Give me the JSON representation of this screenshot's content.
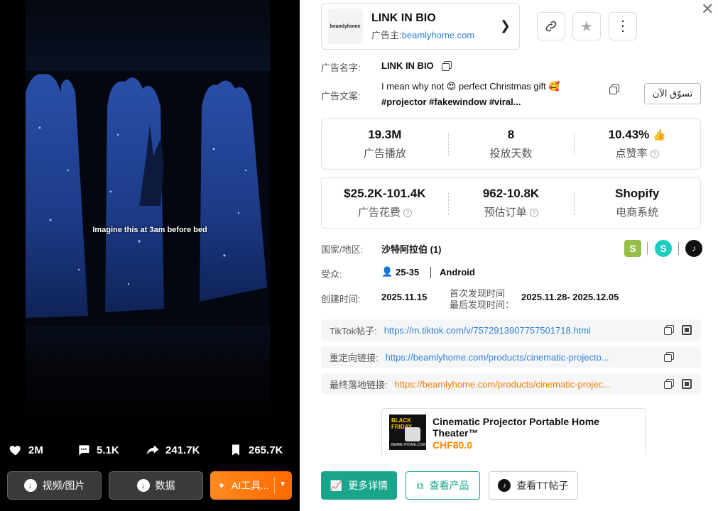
{
  "video": {
    "subtitle": "Imagine this at 3am before bed",
    "stats": {
      "likes": "2M",
      "comments": "5.1K",
      "shares": "241.7K",
      "saves": "265.7K"
    },
    "buttons": {
      "download_media": "视频/图片",
      "download_data": "数据",
      "ai_tools": "AI工具..."
    }
  },
  "advertiser": {
    "logo_text": "beamlyhome",
    "title": "LINK IN BIO",
    "advertiser_label": "广告主:",
    "advertiser_domain": "beamlyhome.com"
  },
  "details": {
    "ad_name_label": "广告名字:",
    "ad_name": "LINK IN BIO",
    "ad_copy_label": "广告文案:",
    "ad_copy_line1": "I mean why not 😍 perfect Christmas gift 🥰",
    "ad_copy_line2": "#projector #fakewindow #viral...",
    "shop_now": "تسوّق الآن",
    "region_label": "国家/地区:",
    "region": "沙特阿拉伯 (1)",
    "audience_label": "受众:",
    "audience_age": "25-35",
    "audience_os": "Android",
    "created_label": "创建时间:",
    "created": "2025.11.15",
    "first_seen_label": "首次发现时间",
    "last_seen_label": "最后发现时间：",
    "seen_range": "2025.11.28- 2025.12.05"
  },
  "metrics_row1": [
    {
      "value": "19.3M",
      "label": "广告播放"
    },
    {
      "value": "8",
      "label": "投放天数"
    },
    {
      "value": "10.43%",
      "label": "点赞率"
    }
  ],
  "metrics_row2": [
    {
      "value": "$25.2K-101.4K",
      "label": "广告花费"
    },
    {
      "value": "962-10.8K",
      "label": "预估订单"
    },
    {
      "value": "Shopify",
      "label": "电商系统"
    }
  ],
  "links": {
    "tiktok_label": "TikTok帖子:",
    "tiktok_url": "https://m.tiktok.com/v/7572913907757501718.html",
    "redirect_label": "重定向链接:",
    "redirect_url": "https://beamlyhome.com/products/cinematic-projecto...",
    "landing_label": "最终落地链接:",
    "landing_url": "https://beamlyhome.com/products/cinematic-projec..."
  },
  "product": {
    "image_badge": "BLACK FRIDAY",
    "image_domain": "BEAMLYHOME.COM",
    "title": "Cinematic Projector Portable Home Theater™",
    "price": "CHF80.0"
  },
  "actions": {
    "more_details": "更多详情",
    "view_product": "查看产品",
    "view_tt_post": "查看TT帖子"
  },
  "colors": {
    "accent_green": "#1aa58a",
    "link_blue": "#2f80d6",
    "link_orange": "#f07d00",
    "ai_orange": "#ff7a0a"
  }
}
